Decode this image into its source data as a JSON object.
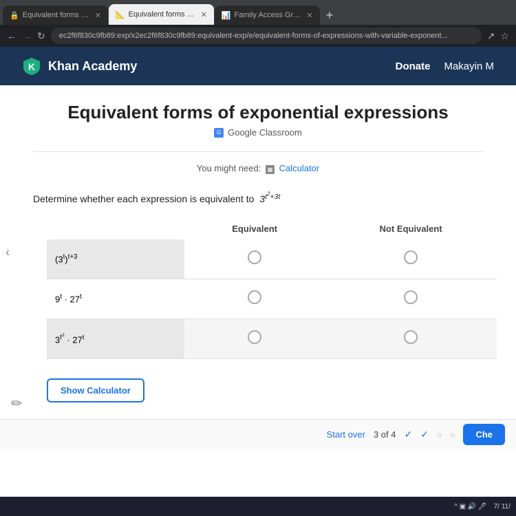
{
  "browser": {
    "tabs": [
      {
        "id": "tab1",
        "label": "Equivalent forms of exponential",
        "active": false,
        "favicon": "✓"
      },
      {
        "id": "tab2",
        "label": "Equivalent forms of exponenti…",
        "active": true,
        "favicon": "📐"
      },
      {
        "id": "tab3",
        "label": "Family Access Gradebook",
        "active": false,
        "favicon": "📊"
      }
    ],
    "new_tab_label": "+",
    "address": "ec2f6f830c9fb89:exp/x2ec2f6f830c9fb89:equivalent-exp/e/equivalent-forms-of-expressions-with-variable-exponent...",
    "share_icon": "↗",
    "star_icon": "☆"
  },
  "header": {
    "logo_text": "Khan Academy",
    "donate_label": "Donate",
    "user_label": "Makayin M"
  },
  "page": {
    "title": "Equivalent forms of exponential expressions",
    "google_classroom_label": "Google Classroom",
    "you_might_need_label": "You might need:",
    "calculator_label": "Calculator",
    "problem_intro": "Determine whether each expression is equivalent to",
    "target_expression": "3^(t²+3t)",
    "table": {
      "headers": [
        "",
        "Equivalent",
        "Not Equivalent"
      ],
      "rows": [
        {
          "expression": "(3^t)^(t+3)",
          "equivalent_selected": false,
          "not_equivalent_selected": false
        },
        {
          "expression": "9^t · 27^t",
          "equivalent_selected": false,
          "not_equivalent_selected": false
        },
        {
          "expression": "3^(t²) · 27^t",
          "equivalent_selected": false,
          "not_equivalent_selected": false
        }
      ]
    },
    "show_calculator_label": "Show Calculator"
  },
  "bottom_bar": {
    "start_over_label": "Start over",
    "progress_label": "3 of 4",
    "check_marks": [
      "✓",
      "✓",
      "○",
      "○"
    ],
    "check_button_label": "Che"
  },
  "taskbar": {
    "time": "7/ 11/"
  }
}
